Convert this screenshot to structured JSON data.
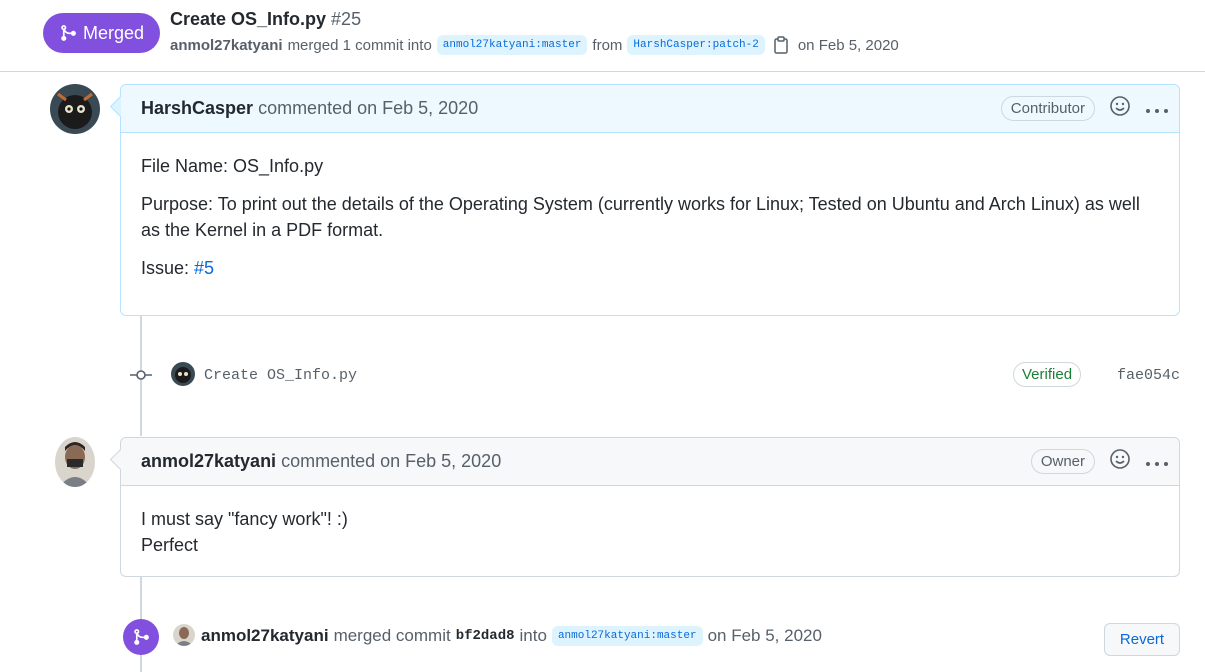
{
  "header": {
    "state": "Merged",
    "title": "Create OS_Info.py",
    "number": "#25",
    "author": "anmol27katyani",
    "merged_text": "merged 1 commit into",
    "base_branch": "anmol27katyani:master",
    "from_text": "from",
    "head_branch": "HarshCasper:patch-2",
    "date": "on Feb 5, 2020"
  },
  "comments": [
    {
      "author": "HarshCasper",
      "meta": "commented on Feb 5, 2020",
      "role": "Contributor",
      "body": {
        "line1": "File Name: OS_Info.py",
        "line2": "Purpose: To print out the details of the Operating System (currently works for Linux; Tested on Ubuntu and Arch Linux) as well as the Kernel in a PDF format.",
        "issue_label": "Issue:",
        "issue_link": "#5"
      }
    },
    {
      "author": "anmol27katyani",
      "meta": "commented on Feb 5, 2020",
      "role": "Owner",
      "body": {
        "line1": "I must say \"fancy work\"! :)",
        "line2": "Perfect"
      }
    }
  ],
  "commit": {
    "message": "Create OS_Info.py",
    "verified": "Verified",
    "sha": "fae054c"
  },
  "merge_event": {
    "author": "anmol27katyani",
    "text": "merged commit",
    "sha": "bf2dad8",
    "into": "into",
    "branch": "anmol27katyani:master",
    "date": "on Feb 5, 2020",
    "revert_label": "Revert"
  },
  "colors": {
    "merged_purple": "#8250df",
    "link_blue": "#0969da",
    "verified_green": "#1a7f37"
  }
}
